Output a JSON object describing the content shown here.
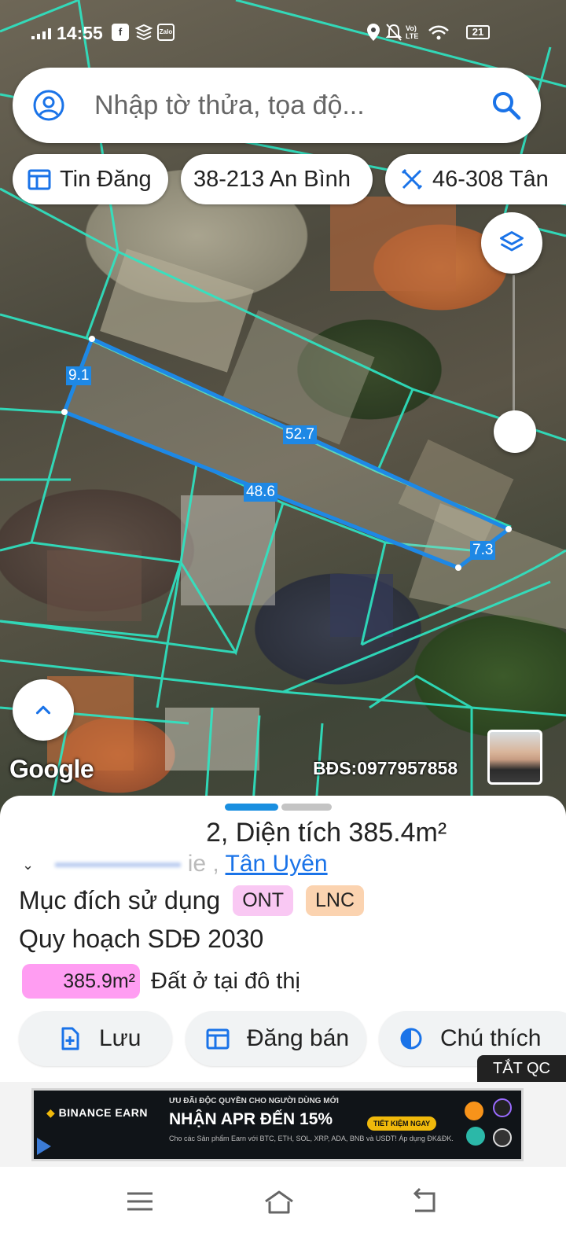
{
  "status_bar": {
    "time": "14:55",
    "zalo_label": "Zalo",
    "volte_label": "Vo) LTE",
    "battery": "21"
  },
  "search": {
    "placeholder": "Nhập tờ thửa, tọa độ..."
  },
  "chips": [
    {
      "label": "Tin Đăng",
      "icon": "calendar-table-icon"
    },
    {
      "label": "38-213 An Bình",
      "icon": ""
    },
    {
      "label": "46-308 Tân",
      "icon": "ruler-tools-icon"
    }
  ],
  "map": {
    "edge_labels": [
      "9.1",
      "52.7",
      "48.6",
      "7.3"
    ],
    "watermark": "Google",
    "agent_contact": "BĐS:0977957858",
    "parcel_color": "#1e88e5",
    "boundary_color": "#2ee6c4"
  },
  "sheet": {
    "title": "2, Diện tích 385.4m²",
    "address_suffix": "ie ,",
    "address_link": "Tân Uyên",
    "usage_label": "Mục đích sử dụng",
    "usage_tags": [
      {
        "label": "ONT",
        "color": "#f9c8f3"
      },
      {
        "label": "LNC",
        "color": "#fbd3b0"
      }
    ],
    "planning_label": "Quy hoạch SDĐ 2030",
    "planning_area": "385.9m²",
    "planning_area_color": "#ff9df2",
    "planning_desc": "Đất ở tại đô thị",
    "actions": [
      {
        "label": "Lưu",
        "icon": "save-file-icon"
      },
      {
        "label": "Đăng bán",
        "icon": "calendar-table-icon"
      },
      {
        "label": "Chú thích",
        "icon": "half-circle-icon"
      }
    ],
    "hide_ads": "TẮT QC"
  },
  "ad": {
    "brand": "BINANCE EARN",
    "tagline": "ƯU ĐÃI ĐỘC QUYỀN CHO NGƯỜI DÙNG MỚI",
    "headline": "NHẬN APR ĐẾN 15%",
    "cta": "TIẾT KIỆM NGAY",
    "subtext": "Cho các Sản phẩm Earn với BTC, ETH, SOL, XRP, ADA, BNB và USDT! Áp dụng ĐK&ĐK."
  },
  "accent": "#1a73e8"
}
